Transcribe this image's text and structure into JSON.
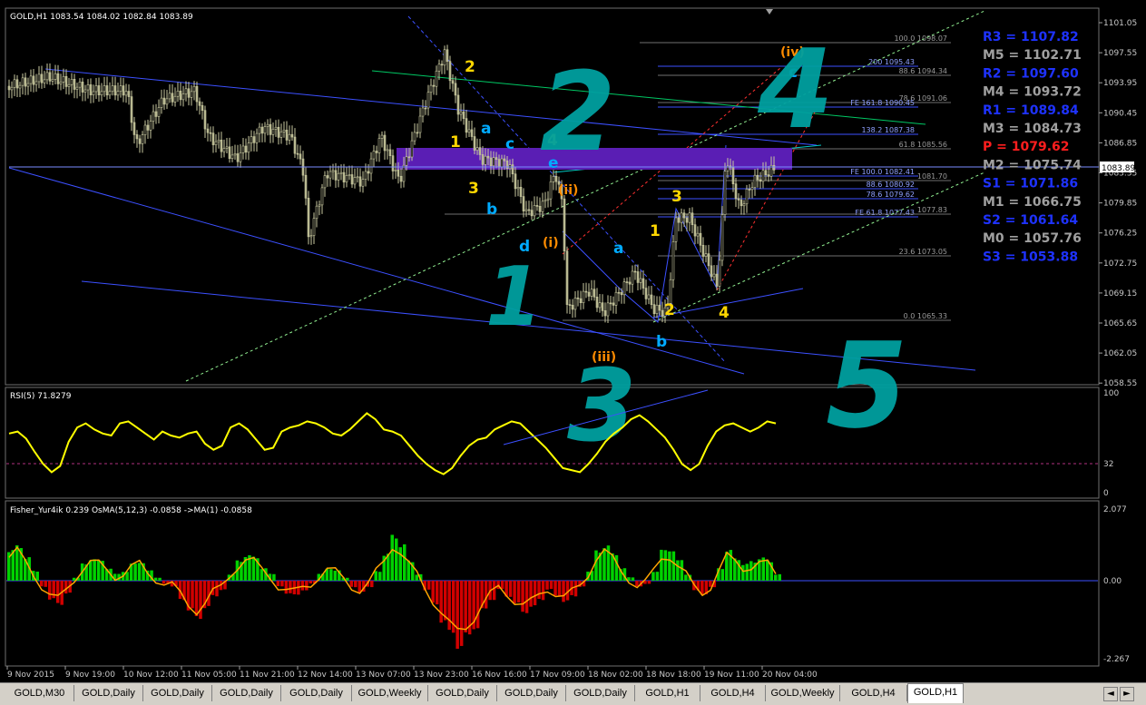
{
  "window": {
    "symbol_header": "GOLD,H1  1083.54 1084.02 1082.84 1083.89",
    "current_price": "1083.89",
    "current_price_value": 1083.89
  },
  "price_axis": {
    "min": 1057.5,
    "max": 1102.5,
    "ticks": [
      "1101.05",
      "1097.55",
      "1093.95",
      "1090.45",
      "1086.85",
      "1083.35",
      "1079.85",
      "1076.25",
      "1072.75",
      "1069.15",
      "1065.65",
      "1062.05",
      "1058.55"
    ]
  },
  "pivots": [
    {
      "label": "R3 = 1107.82",
      "color": "#1e32ff"
    },
    {
      "label": "M5 = 1102.71",
      "color": "#a0a0a0"
    },
    {
      "label": "R2 = 1097.60",
      "color": "#1e32ff"
    },
    {
      "label": "M4 = 1093.72",
      "color": "#a0a0a0"
    },
    {
      "label": "R1 = 1089.84",
      "color": "#1e32ff"
    },
    {
      "label": "M3 = 1084.73",
      "color": "#a0a0a0"
    },
    {
      "label": "P   = 1079.62",
      "color": "#ff1e1e"
    },
    {
      "label": "M2 = 1075.74",
      "color": "#a0a0a0"
    },
    {
      "label": "S1 = 1071.86",
      "color": "#1e32ff"
    },
    {
      "label": "M1 = 1066.75",
      "color": "#a0a0a0"
    },
    {
      "label": "S2 = 1061.64",
      "color": "#1e32ff"
    },
    {
      "label": "M0 = 1057.76",
      "color": "#a0a0a0"
    },
    {
      "label": "S3 = 1053.88",
      "color": "#1e32ff"
    }
  ],
  "fib_levels": [
    {
      "label": "100.0 1098.07",
      "price": 1098.07
    },
    {
      "label": "200 1095.43",
      "price": 1095.43
    },
    {
      "label": "88.6 1094.34",
      "price": 1094.34
    },
    {
      "label": "78.6 1091.06",
      "price": 1091.06
    },
    {
      "label": "FE 161.8 1090.45",
      "price": 1090.45
    },
    {
      "label": "138.2 1087.38",
      "price": 1087.38
    },
    {
      "label": "61.8 1085.56",
      "price": 1085.56
    },
    {
      "label": "FE 100.0 1082.41",
      "price": 1082.41
    },
    {
      "label": "1081.70",
      "price": 1081.7
    },
    {
      "label": "88.6 1080.92",
      "price": 1080.92
    },
    {
      "label": "78.6 1079.62",
      "price": 1079.62
    },
    {
      "label": "FE 61.8 1077.43",
      "price": 1077.43
    },
    {
      "label": "1077.83",
      "price": 1077.83
    },
    {
      "label": "23.6 1073.05",
      "price": 1073.05
    },
    {
      "label": "0.0 1065.33",
      "price": 1065.33
    }
  ],
  "wave_labels": [
    {
      "text": "2",
      "color": "#ffd700"
    },
    {
      "text": "1",
      "color": "#ffd700"
    },
    {
      "text": "3",
      "color": "#ffd700"
    },
    {
      "text": "4",
      "color": "#ffd700"
    },
    {
      "text": "a",
      "color": "#00aaff"
    },
    {
      "text": "b",
      "color": "#00aaff"
    },
    {
      "text": "c",
      "color": "#00aaff"
    },
    {
      "text": "d",
      "color": "#00aaff"
    },
    {
      "text": "e",
      "color": "#00aaff"
    },
    {
      "text": "(i)",
      "color": "#ff8c00"
    },
    {
      "text": "(ii)",
      "color": "#ff8c00"
    },
    {
      "text": "(iii)",
      "color": "#ff8c00"
    },
    {
      "text": "(iv)",
      "color": "#ff8c00"
    },
    {
      "text": "a",
      "color": "#00aaff"
    },
    {
      "text": "b",
      "color": "#00aaff"
    },
    {
      "text": "c",
      "color": "#00aaff"
    },
    {
      "text": "1",
      "color": "#ffd700"
    },
    {
      "text": "2",
      "color": "#ffd700"
    },
    {
      "text": "3",
      "color": "#ffd700"
    },
    {
      "text": "4",
      "color": "#ffd700"
    }
  ],
  "big_labels": [
    "1",
    "2",
    "3",
    "4",
    "5"
  ],
  "rsi": {
    "header": "RSI(5) 71.8279",
    "ticks": [
      "100",
      "32",
      "0"
    ],
    "values": [
      60,
      62,
      55,
      42,
      30,
      22,
      28,
      52,
      66,
      70,
      64,
      60,
      58,
      70,
      72,
      66,
      60,
      54,
      62,
      58,
      56,
      60,
      62,
      50,
      44,
      48,
      66,
      70,
      64,
      54,
      44,
      46,
      62,
      66,
      68,
      72,
      70,
      66,
      60,
      58,
      64,
      72,
      80,
      74,
      64,
      62,
      58,
      48,
      38,
      30,
      24,
      20,
      26,
      38,
      48,
      54,
      56,
      64,
      68,
      72,
      70,
      62,
      54,
      46,
      36,
      26,
      24,
      22,
      30,
      40,
      52,
      60,
      66,
      74,
      78,
      72,
      64,
      56,
      44,
      30,
      24,
      30,
      48,
      62,
      68,
      70,
      66,
      62,
      66,
      72,
      70
    ],
    "level": 32
  },
  "fisher": {
    "header": "Fisher_Yur4ik 0.239  OsMA(5,12,3) -0.0858  ->MA(1) -0.0858",
    "ticks": [
      "2.077",
      "0.00",
      "-2.267"
    ],
    "values": [
      0.9,
      1.1,
      0.7,
      0.3,
      -0.2,
      -0.6,
      -0.8,
      -0.4,
      0.1,
      0.5,
      0.7,
      0.6,
      0.4,
      0.2,
      0.3,
      0.5,
      0.6,
      0.3,
      0.1,
      -0.1,
      -0.2,
      -0.6,
      -1.0,
      -1.2,
      -0.9,
      -0.5,
      -0.3,
      0.2,
      0.6,
      0.8,
      0.7,
      0.4,
      0.2,
      -0.2,
      -0.4,
      -0.5,
      -0.3,
      -0.1,
      0.2,
      0.4,
      0.3,
      0.1,
      -0.2,
      -0.4,
      -0.2,
      0.3,
      0.8,
      1.4,
      1.1,
      0.6,
      0.2,
      -0.3,
      -0.8,
      -1.3,
      -1.8,
      -2.1,
      -1.9,
      -1.5,
      -1.0,
      -0.6,
      -0.3,
      -0.5,
      -0.8,
      -1.0,
      -0.9,
      -0.6,
      -0.3,
      -0.5,
      -0.7,
      -0.5,
      -0.2,
      0.3,
      0.9,
      1.1,
      0.8,
      0.4,
      0.1,
      -0.2,
      -0.1,
      0.3,
      0.9,
      1.0,
      0.6,
      0.2,
      -0.3,
      -0.5,
      -0.2,
      0.4,
      0.9,
      0.7,
      0.5,
      0.6,
      0.7,
      0.6,
      0.2
    ]
  },
  "time_axis": [
    "9 Nov 2015",
    "9 Nov 19:00",
    "10 Nov 12:00",
    "11 Nov 05:00",
    "11 Nov 21:00",
    "12 Nov 14:00",
    "13 Nov 07:00",
    "13 Nov 23:00",
    "16 Nov 16:00",
    "17 Nov 09:00",
    "18 Nov 02:00",
    "18 Nov 18:00",
    "19 Nov 11:00",
    "20 Nov 04:00"
  ],
  "tabs": [
    "GOLD,M30",
    "GOLD,Daily",
    "GOLD,Daily",
    "GOLD,Daily",
    "GOLD,Daily",
    "GOLD,Weekly",
    "GOLD,Daily",
    "GOLD,Daily",
    "GOLD,Daily",
    "GOLD,H1",
    "GOLD,H4",
    "GOLD,Weekly",
    "GOLD,H4",
    "GOLD,H1"
  ],
  "active_tab": 13,
  "colors": {
    "up": "#00e000",
    "down": "#e00000",
    "rsi": "#ffff00",
    "signal": "#ffa500",
    "trend": "#3c50ff",
    "fib": "#808080",
    "zone": "#5a1eb4",
    "teal": "#00b4b4"
  },
  "chart_data": {
    "type": "line",
    "title": "GOLD,H1",
    "x": [
      "9 Nov 2015",
      "9 Nov 19:00",
      "10 Nov 12:00",
      "11 Nov 05:00",
      "11 Nov 21:00",
      "12 Nov 14:00",
      "13 Nov 07:00",
      "13 Nov 23:00",
      "16 Nov 16:00",
      "17 Nov 09:00",
      "18 Nov 02:00",
      "18 Nov 18:00",
      "19 Nov 11:00",
      "20 Nov 04:00"
    ],
    "series": [
      {
        "name": "GOLD,H1",
        "values": [
          1093.5,
          1092.8,
          1091.2,
          1090.0,
          1088.5,
          1085.0,
          1082.0,
          1096.5,
          1081.5,
          1078.5,
          1068.5,
          1077.0,
          1069.5,
          1083.9
        ]
      }
    ],
    "ylim": [
      1057.5,
      1102.5
    ]
  }
}
